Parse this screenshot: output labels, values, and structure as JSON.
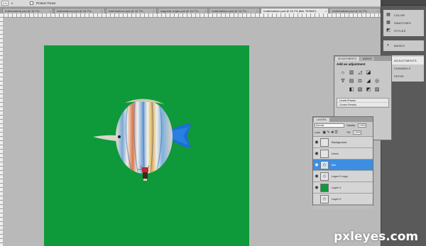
{
  "options_bar": {
    "zoom": "2%",
    "checkbox_label": "Protect Tones"
  },
  "tabs": [
    {
      "label": "butterballoon.psd @ 16.7%...",
      "active": false
    },
    {
      "label": "butterballoon.psd @ 16.7%...",
      "active": false
    },
    {
      "label": "butterballoon.psd @ 16.7%...",
      "active": false
    },
    {
      "label": "magnetic-organ.psd @ 16.7%...",
      "active": false
    },
    {
      "label": "butterballoon.psd @ 16.7%...",
      "active": false
    },
    {
      "label": "butterballoon.psd @ 16.7% (fish, RGB/8*)",
      "active": true
    },
    {
      "label": "butterballoon.psd @ 16.7%...",
      "active": false
    }
  ],
  "dock": {
    "group1": [
      {
        "label": "COLOR",
        "icon": "color-icon"
      },
      {
        "label": "SWATCHES",
        "icon": "swatches-icon"
      },
      {
        "label": "STYLES",
        "icon": "styles-icon"
      }
    ],
    "group2": [
      {
        "label": "MASKS",
        "icon": "masks-icon"
      }
    ],
    "group3": [
      {
        "label": "ADJUSTMENTS",
        "icon": "adjustments-icon",
        "active": true
      },
      {
        "label": "CHANNELS",
        "icon": "channels-icon"
      },
      {
        "label": "PATHS",
        "icon": "paths-icon"
      }
    ]
  },
  "adjustments": {
    "tabs": [
      "ADJUSTMENTS",
      "MASKS"
    ],
    "heading": "Add an adjustment",
    "presets": [
      "Levels Presets",
      "Curves Presets"
    ]
  },
  "layers": {
    "tab": "LAYERS",
    "blend_mode": "Normal",
    "opacity_label": "Opacity:",
    "opacity": "100%",
    "lock_label": "Lock:",
    "fill_label": "Fill:",
    "fill": "100%",
    "items": [
      {
        "name": "Background",
        "selected": false,
        "visible": true
      },
      {
        "name": "Lines",
        "selected": false,
        "visible": true
      },
      {
        "name": "fish",
        "selected": true,
        "visible": true
      },
      {
        "name": "Layer 0 copy",
        "selected": false,
        "visible": true
      },
      {
        "name": "Layer 2",
        "selected": false,
        "visible": true
      },
      {
        "name": "Layer 0",
        "selected": false,
        "visible": false
      }
    ]
  },
  "colors": {
    "canvas": "#0e9a3a",
    "selection": "#3d8ee0"
  },
  "watermark": "pxleyes.com"
}
